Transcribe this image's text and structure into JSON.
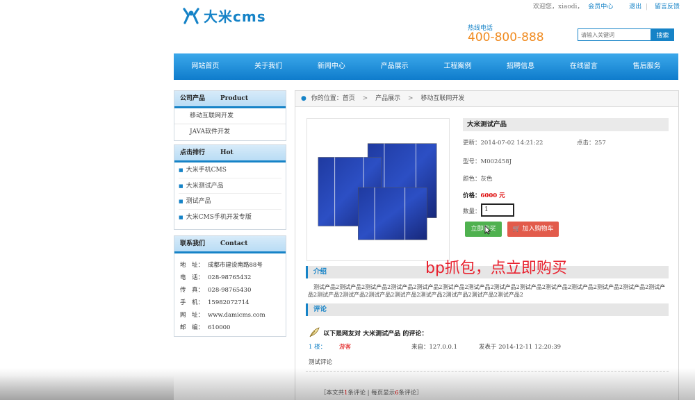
{
  "header": {
    "logo_text": "大米cms",
    "top_links": {
      "welcome": "欢迎您，xiaodi，",
      "member_center": "会员中心",
      "logout": "退出",
      "feedback": "留言反馈"
    },
    "hotline_label": "热线电话",
    "hotline_number": "400-800-888",
    "search": {
      "placeholder": "请输入关键词",
      "button": "搜索"
    }
  },
  "nav": [
    "网站首页",
    "关于我们",
    "新闻中心",
    "产品展示",
    "工程案例",
    "招聘信息",
    "在线留言",
    "售后服务"
  ],
  "sidebar": {
    "products": {
      "title": "公司产品",
      "title_en": "Product",
      "items": [
        "移动互联网开发",
        "JAVA软件开发"
      ]
    },
    "hot": {
      "title": "点击排行",
      "title_en": "Hot",
      "items": [
        "大米手机CMS",
        "大米测试产品",
        "测试产品",
        "大米CMS手机开发专版"
      ]
    },
    "contact": {
      "title": "联系我们",
      "title_en": "Contact",
      "rows": [
        {
          "k": "地　址：",
          "v": "成都市建设南路88号"
        },
        {
          "k": "电　话：",
          "v": "028-98765432"
        },
        {
          "k": "传　真：",
          "v": "028-98765430"
        },
        {
          "k": "手　机：",
          "v": "15982072714"
        },
        {
          "k": "网　址：",
          "v": "www.damicms.com"
        },
        {
          "k": "邮　编：",
          "v": "610000"
        }
      ]
    }
  },
  "breadcrumb": {
    "prefix": "你的位置：",
    "items": [
      "首页",
      "产品展示",
      "移动互联网开发"
    ]
  },
  "product": {
    "name": "大米测试产品",
    "updated": "更新：2014-07-02 14:21:22",
    "clicks": "点击：257",
    "model": "型号：M002458J",
    "color": "颜色：灰色",
    "price_label": "价格：",
    "price_value": "6000 元",
    "qty_label": "数量：",
    "qty_value": "1",
    "buy_button": "立即购买",
    "cart_button": "加入购物车"
  },
  "intro": {
    "title": "介绍",
    "text": "测试产品2测试产品2测试产品2测试产品2测试产品2测试产品2测试产品2测试产品2测试产品2测试产品2测试产品2测试产品2测试产品2测试产品2测试产品2测试产品2测试产品2测试产品2测试产品2测试产品2测试产品2测试产品2"
  },
  "comments": {
    "title": "评论",
    "heading_prefix": "以下是网友对",
    "heading_product": "大米测试产品",
    "heading_suffix": "的评论：",
    "items": [
      {
        "floor": "1 楼：",
        "user": "游客",
        "from": "来自：127.0.0.1",
        "time": "发表于 2014-12-11 12:20:39",
        "content": "测试评论"
      }
    ],
    "footer_prefix": "［本文共",
    "footer_count": "1",
    "footer_mid": "条评论 | 每页显示",
    "footer_per": "6",
    "footer_suffix": "条评论］"
  },
  "overlay_text": "bp抓包，点立即购买",
  "colors": {
    "brand": "#1683c7",
    "orange": "#f08a1e",
    "buy_green": "#4fb14f",
    "cart_red": "#e25b4b",
    "overlay_red": "#e8212e"
  }
}
